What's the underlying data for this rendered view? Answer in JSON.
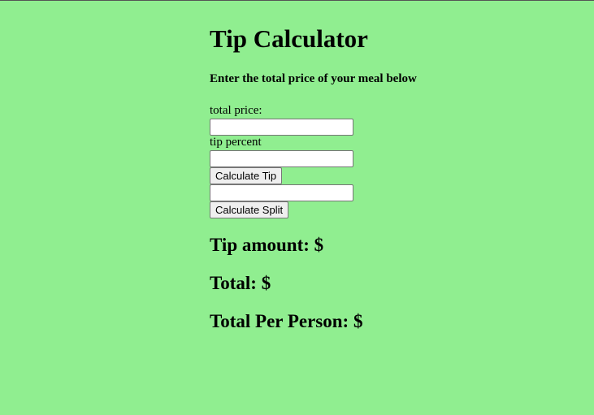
{
  "colors": {
    "background": "#90ee90"
  },
  "page": {
    "title": "Tip Calculator",
    "subtitle": "Enter the total price of your meal below"
  },
  "form": {
    "total_price_label": "total price:",
    "total_price_value": "",
    "tip_percent_label": "tip percent",
    "tip_percent_value": "",
    "calculate_tip_label": "Calculate Tip",
    "split_value": "",
    "calculate_split_label": "Calculate Split"
  },
  "results": {
    "tip_amount": "Tip amount: $",
    "total": "Total: $",
    "total_per_person": "Total Per Person: $"
  }
}
